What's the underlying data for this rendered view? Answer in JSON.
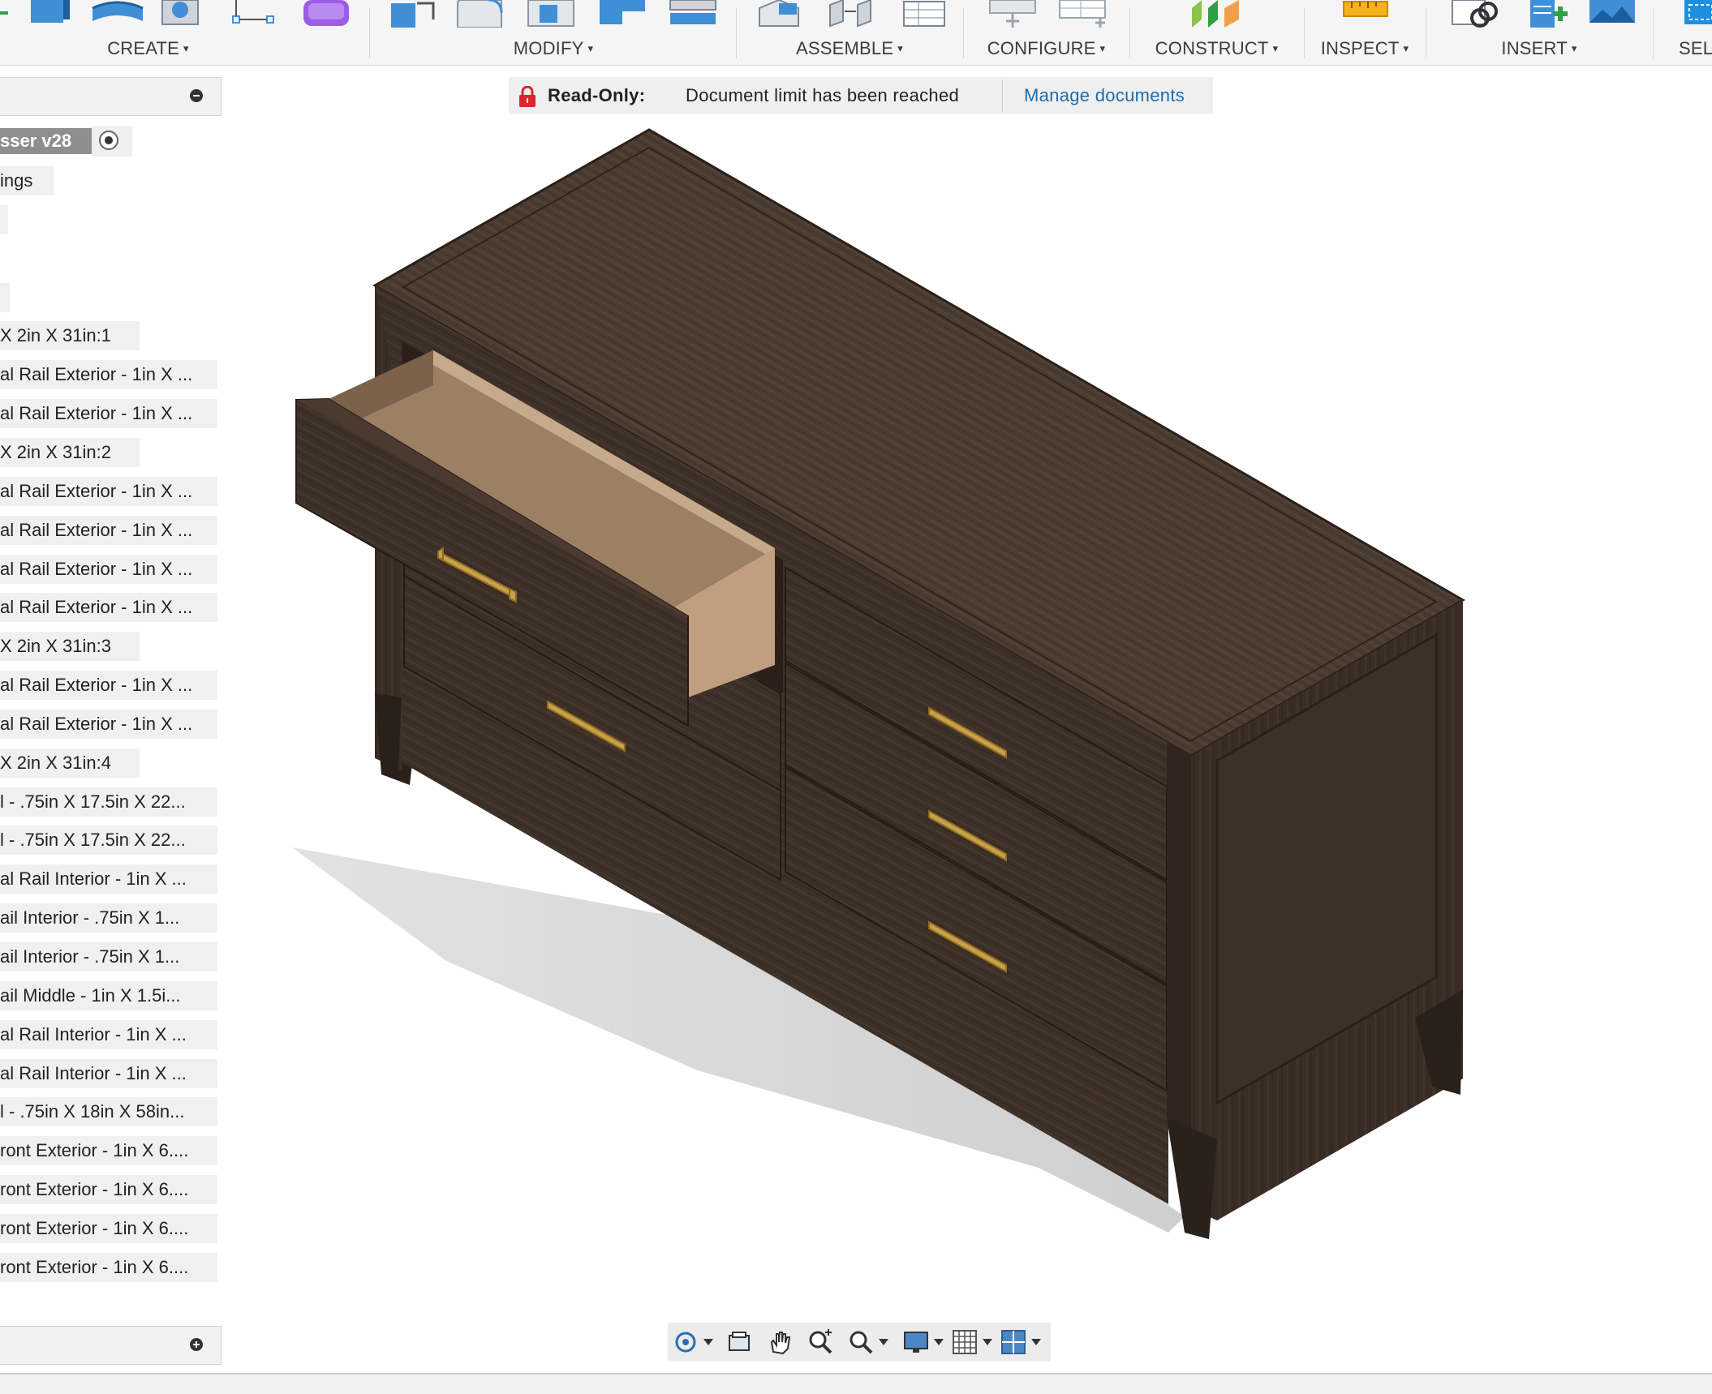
{
  "toolbar": {
    "groups": [
      {
        "id": "create",
        "label": "CREATE"
      },
      {
        "id": "modify",
        "label": "MODIFY"
      },
      {
        "id": "assemble",
        "label": "ASSEMBLE"
      },
      {
        "id": "configure",
        "label": "CONFIGURE"
      },
      {
        "id": "construct",
        "label": "CONSTRUCT"
      },
      {
        "id": "inspect",
        "label": "INSPECT"
      },
      {
        "id": "insert",
        "label": "INSERT"
      },
      {
        "id": "select",
        "label": "SELE"
      }
    ],
    "caret": "▾"
  },
  "banner": {
    "label": "Read-Only:",
    "message": "Document limit has been reached",
    "link": "Manage documents"
  },
  "browser": {
    "root": "sser v28",
    "rows": [
      "ings",
      "",
      "",
      "",
      " X 2in X 31in:1",
      "al Rail Exterior - 1in X ...",
      "al Rail Exterior - 1in X ...",
      " X 2in X 31in:2",
      "al Rail Exterior - 1in X ...",
      "al Rail Exterior - 1in X ...",
      "al Rail Exterior - 1in X ...",
      "al Rail Exterior - 1in X ...",
      " X 2in X 31in:3",
      "al Rail Exterior - 1in X ...",
      "al Rail Exterior - 1in X ...",
      " X 2in X 31in:4",
      "l - .75in X 17.5in X 22...",
      "l - .75in X 17.5in X 22...",
      "al Rail Interior - 1in X ...",
      "ail Interior - .75in X 1...",
      "ail Interior - .75in X 1...",
      "ail Middle - 1in X 1.5i...",
      "al Rail Interior - 1in X ...",
      "al Rail Interior - 1in X ...",
      "l - .75in X 18in X 58in...",
      "ront Exterior - 1in X 6....",
      "ront Exterior - 1in X 6....",
      "ront Exterior - 1in X 6....",
      "ront Exterior - 1in X 6...."
    ]
  },
  "colors": {
    "wood": "#3b2e26",
    "wood_top": "#4a3a30",
    "wood_dark": "#2a201a",
    "drawer_inside": "#b7987a",
    "handle": "#c9a14a",
    "link": "#1d6ba8",
    "lock": "#d9262c"
  }
}
